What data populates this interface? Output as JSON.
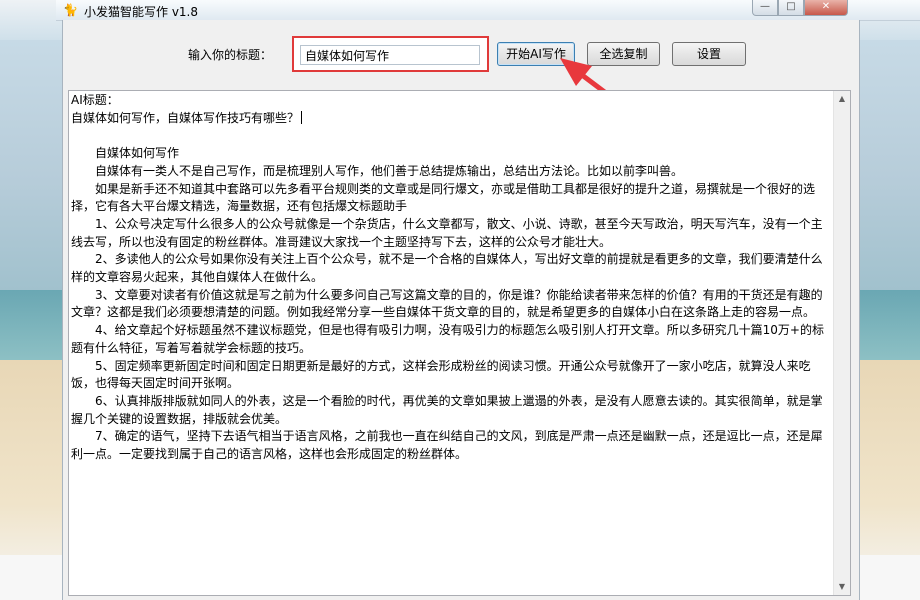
{
  "window": {
    "title": "小发猫智能写作 v1.8",
    "minimize_glyph": "—",
    "maximize_glyph": "□",
    "close_glyph": "✕"
  },
  "toolbar": {
    "title_label": "输入你的标题：",
    "title_value": "自媒体如何写作",
    "start_button": "开始AI写作",
    "copy_all_button": "全选复制",
    "settings_button": "设置"
  },
  "output": {
    "ai_title_label": "AI标题：",
    "ai_title": "自媒体如何写作，自媒体写作技巧有哪些？",
    "article_heading": "自媒体如何写作",
    "paragraphs": [
      "自媒体有一类人不是自己写作，而是梳理别人写作，他们善于总结提炼输出，总结出方法论。比如以前李叫兽。",
      "如果是新手还不知道其中套路可以先多看平台规则类的文章或是同行爆文，亦或是借助工具都是很好的提升之道，易撰就是一个很好的选择，它有各大平台爆文精选，海量数据，还有包括爆文标题助手",
      "1、公众号决定写什么很多人的公众号就像是一个杂货店，什么文章都写，散文、小说、诗歌，甚至今天写政治，明天写汽车，没有一个主线去写，所以也没有固定的粉丝群体。准哥建议大家找一个主题坚持写下去，这样的公众号才能壮大。",
      "2、多读他人的公众号如果你没有关注上百个公众号，就不是一个合格的自媒体人，写出好文章的前提就是看更多的文章，我们要清楚什么样的文章容易火起来，其他自媒体人在做什么。",
      "3、文章要对读者有价值这就是写之前为什么要多问自己写这篇文章的目的，你是谁？你能给读者带来怎样的价值？有用的干货还是有趣的文章？这都是我们必须要想清楚的问题。例如我经常分享一些自媒体干货文章的目的，就是希望更多的自媒体小白在这条路上走的容易一点。",
      "4、给文章起个好标题虽然不建议标题党，但是也得有吸引力啊，没有吸引力的标题怎么吸引别人打开文章。所以多研究几十篇10万+的标题有什么特征，写着写着就学会标题的技巧。",
      "5、固定频率更新固定时间和固定日期更新是最好的方式，这样会形成粉丝的阅读习惯。开通公众号就像开了一家小吃店，就算没人来吃饭，也得每天固定时间开张啊。",
      "6、认真排版排版就如同人的外表，这是一个看脸的时代，再优美的文章如果披上邋遢的外表，是没有人愿意去读的。其实很简单，就是掌握几个关键的设置数据，排版就会优美。",
      "7、确定的语气，坚持下去语气相当于语言风格，之前我也一直在纠结自己的文风，到底是严肃一点还是幽默一点，还是逗比一点，还是犀利一点。一定要找到属于自己的语言风格，这样也会形成固定的粉丝群体。"
    ]
  },
  "colors": {
    "highlight_border": "#e03a3a",
    "arrow": "#e8383d"
  }
}
